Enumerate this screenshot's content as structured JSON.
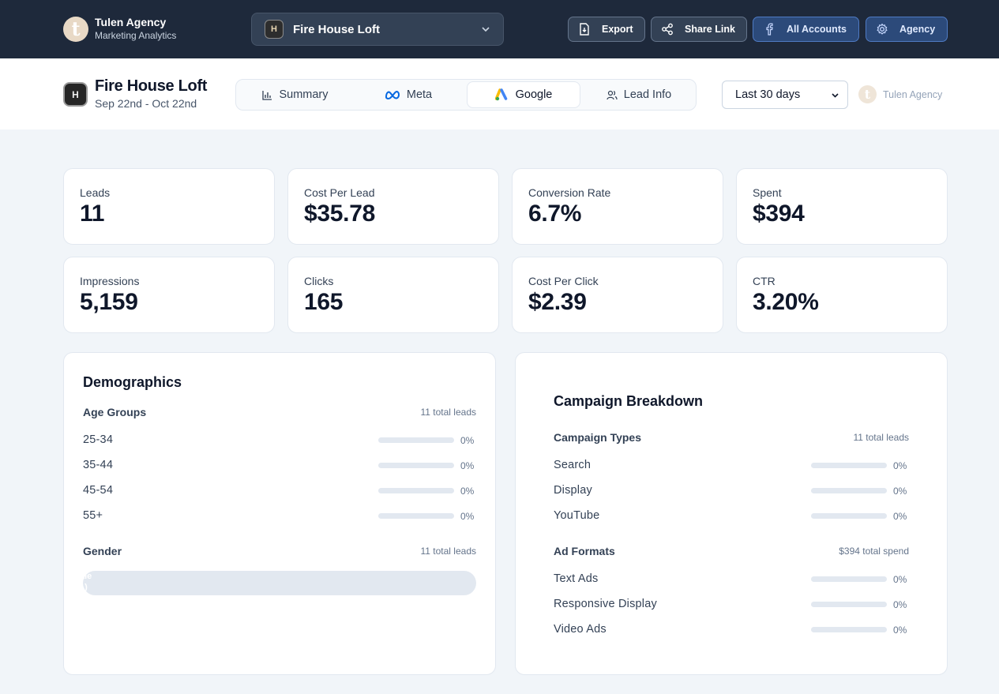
{
  "brand": {
    "logo_letter": "t",
    "name": "Tulen Agency",
    "subtitle": "Marketing Analytics"
  },
  "account_selector": {
    "logo_letter": "H",
    "selected": "Fire House Loft"
  },
  "toolbar": {
    "export_label": "Export",
    "share_label": "Share Link",
    "accounts_label": "All Accounts",
    "agency_label": "Agency"
  },
  "client": {
    "logo_letter": "H",
    "name": "Fire House Loft",
    "dates": "Sep 22nd - Oct 22nd"
  },
  "tabs": [
    {
      "label": "Summary",
      "icon": "bar-chart-icon",
      "active": false
    },
    {
      "label": "Meta",
      "icon": "meta-icon",
      "active": false
    },
    {
      "label": "Google",
      "icon": "google-ads-icon",
      "active": true
    },
    {
      "label": "Lead Info",
      "icon": "users-icon",
      "active": false
    }
  ],
  "date_range": {
    "selected": "Last 30 days"
  },
  "powered_by": {
    "logo_letter": "t",
    "name": "Tulen Agency"
  },
  "metrics": [
    {
      "label": "Leads",
      "value": "11"
    },
    {
      "label": "Cost Per Lead",
      "value": "$35.78"
    },
    {
      "label": "Conversion Rate",
      "value": "6.7%"
    },
    {
      "label": "Spent",
      "value": "$394"
    },
    {
      "label": "Impressions",
      "value": "5,159"
    },
    {
      "label": "Clicks",
      "value": "165"
    },
    {
      "label": "Cost Per Click",
      "value": "$2.39"
    },
    {
      "label": "CTR",
      "value": "3.20%"
    }
  ],
  "demographics": {
    "title": "Demographics",
    "age": {
      "title": "Age Groups",
      "note": "11 total leads",
      "rows": [
        {
          "label": "25-34",
          "pct": "0%",
          "fill": 0
        },
        {
          "label": "35-44",
          "pct": "0%",
          "fill": 0
        },
        {
          "label": "45-54",
          "pct": "0%",
          "fill": 0
        },
        {
          "label": "55+",
          "pct": "0%",
          "fill": 0
        }
      ]
    },
    "gender": {
      "title": "Gender",
      "note": "11 total leads",
      "bar_text_1": "ale",
      "bar_text_2": "1)"
    }
  },
  "campaigns": {
    "title": "Campaign Breakdown",
    "types": {
      "title": "Campaign Types",
      "note": "11 total leads",
      "rows": [
        {
          "label": "Search",
          "pct": "0%",
          "fill": 0
        },
        {
          "label": "Display",
          "pct": "0%",
          "fill": 0
        },
        {
          "label": "YouTube",
          "pct": "0%",
          "fill": 0
        }
      ]
    },
    "formats": {
      "title": "Ad Formats",
      "note": "$394 total spend",
      "rows": [
        {
          "label": "Text Ads",
          "pct": "0%",
          "fill": 0
        },
        {
          "label": "Responsive Display",
          "pct": "0%",
          "fill": 0
        },
        {
          "label": "Video Ads",
          "pct": "0%",
          "fill": 0
        }
      ]
    }
  }
}
